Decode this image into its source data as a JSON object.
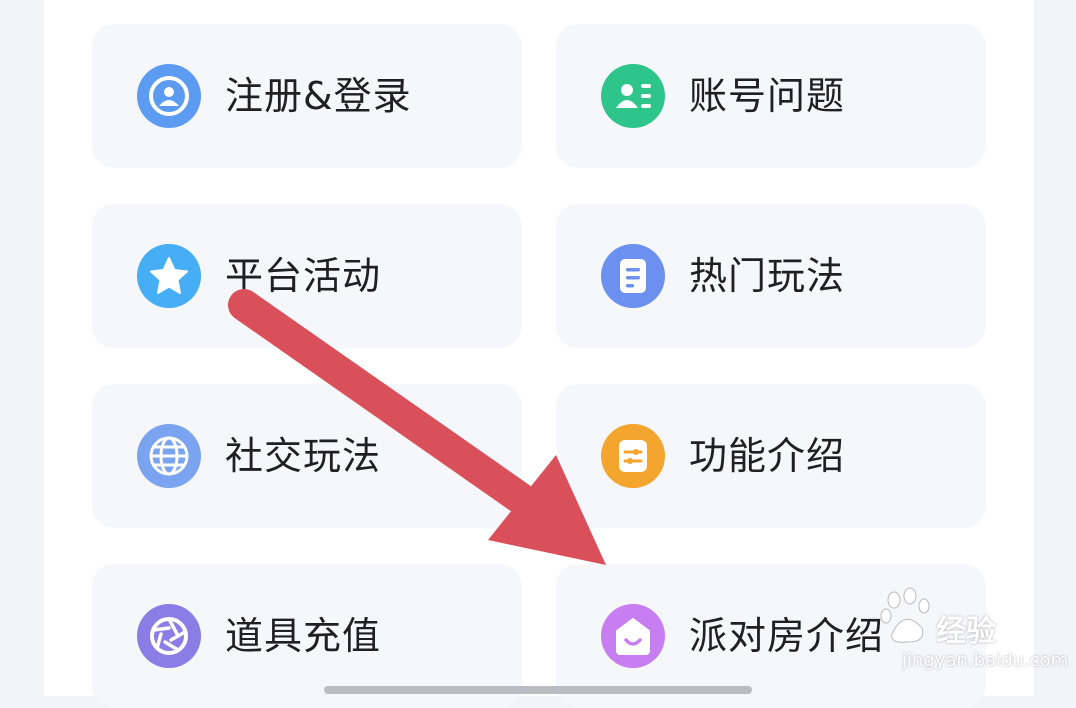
{
  "menu": {
    "items": [
      {
        "label": "注册&登录",
        "icon": "user-icon",
        "color": "#5b9cf2"
      },
      {
        "label": "账号问题",
        "icon": "id-card-icon",
        "color": "#2ec58a"
      },
      {
        "label": "平台活动",
        "icon": "star-icon",
        "color": "#45aef5"
      },
      {
        "label": "热门玩法",
        "icon": "document-icon",
        "color": "#6c90ef"
      },
      {
        "label": "社交玩法",
        "icon": "globe-icon",
        "color": "#7aa4ef"
      },
      {
        "label": "功能介绍",
        "icon": "sliders-icon",
        "color": "#f4a52d"
      },
      {
        "label": "道具充值",
        "icon": "aperture-icon",
        "color": "#8b7ce6"
      },
      {
        "label": "派对房介绍",
        "icon": "house-icon",
        "color": "#c77ef0"
      }
    ]
  },
  "annotation": {
    "arrow_color": "#d9505a"
  },
  "watermark": {
    "brand": "经验",
    "url": "jingyan.baidu.com"
  }
}
